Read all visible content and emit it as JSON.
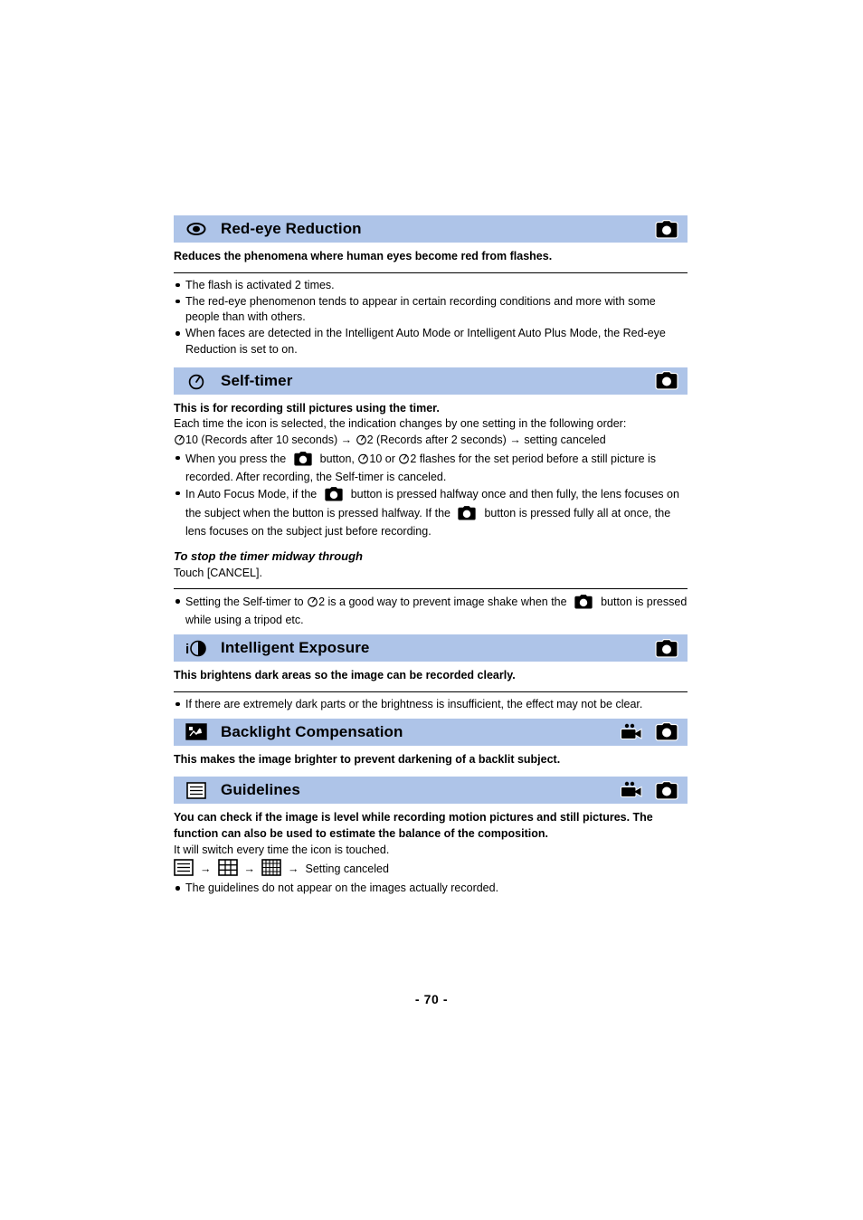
{
  "page": {
    "number_label": "- 70 -",
    "header_bar_color": "#aec4e8"
  },
  "sections": [
    {
      "id": "red-eye-reduction",
      "title": "Red-eye Reduction",
      "left_icon": "eye-icon",
      "right_icons": [
        "photo-camera-icon"
      ],
      "lead": "Reduces the phenomena where human eyes become red from flashes.",
      "bullets": [
        "The flash is activated 2 times.",
        "The red-eye phenomenon tends to appear in certain recording conditions and more with some people than with others.",
        "When faces are detected in the Intelligent Auto Mode or Intelligent Auto Plus Mode, the Red-eye Reduction is set to on."
      ]
    },
    {
      "id": "self-timer",
      "title": "Self-timer",
      "left_icon": "self-timer-icon",
      "right_icons": [
        "photo-camera-icon"
      ],
      "lead": "This is for recording still pictures using the timer.",
      "intro": "Each time the icon is selected, the indication changes by one setting in the following order:",
      "sequence": {
        "part1": "10 (Records after 10 seconds)",
        "arrow1": "→",
        "part2": "2 (Records after 2 seconds)",
        "arrow2": "→",
        "part3": "setting canceled"
      },
      "bullets": [
        {
          "t1": "When you press the",
          "t2": "button,",
          "t3": "10 or",
          "t4": "2 flashes for the set period before a still picture is recorded. After recording, the Self-timer is canceled."
        },
        {
          "t1": "In Auto Focus Mode, if the",
          "t2": "button is pressed halfway once and then fully, the lens focuses on the subject when the button is pressed halfway. If the",
          "t3": "button is pressed fully all at once, the lens focuses on the subject just before recording."
        }
      ],
      "stop_heading": "To stop the timer midway through",
      "stop_text": "Touch [CANCEL].",
      "footer_bullet": {
        "t1": "Setting the Self-timer to",
        "t2": "2 is a good way to prevent image shake when the",
        "t3": "button is pressed while using a tripod etc."
      }
    },
    {
      "id": "intelligent-exposure",
      "title": "Intelligent Exposure",
      "left_icon": "intelligent-exposure-icon",
      "right_icons": [
        "photo-camera-icon"
      ],
      "lead": "This brightens dark areas so the image can be recorded clearly.",
      "bullets": [
        "If there are extremely dark parts or the brightness is insufficient, the effect may not be clear."
      ]
    },
    {
      "id": "backlight-compensation",
      "title": "Backlight Compensation",
      "left_icon": "backlight-compensation-icon",
      "right_icons": [
        "video-camera-icon",
        "photo-camera-icon"
      ],
      "lead": "This makes the image brighter to prevent darkening of a backlit subject.",
      "bullets": []
    },
    {
      "id": "guidelines",
      "title": "Guidelines",
      "left_icon": "guidelines-icon",
      "right_icons": [
        "video-camera-icon",
        "photo-camera-icon"
      ],
      "lead": "You can check if the image is level while recording motion pictures and still pictures. The function can also be used to estimate the balance of the composition.",
      "intro": "It will switch every time the icon is touched.",
      "sequence": {
        "arrow1": "→",
        "arrow2": "→",
        "arrow3": "→",
        "end_label": "Setting canceled"
      },
      "bullets": [
        "The guidelines do not appear on the images actually recorded."
      ]
    }
  ]
}
